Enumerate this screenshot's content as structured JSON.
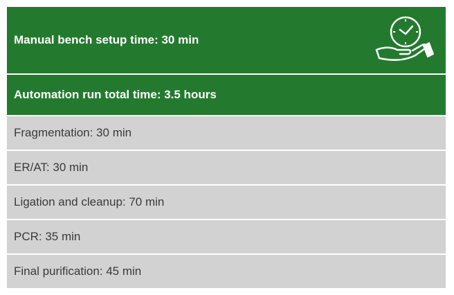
{
  "header": {
    "setup_label": "Manual bench setup time: 30 min",
    "icon": "clock-in-hand-icon",
    "run_label": "Automation run total time: 3.5 hours"
  },
  "steps": [
    {
      "label": "Fragmentation: 30 min"
    },
    {
      "label": "ER/AT: 30 min"
    },
    {
      "label": "Ligation and cleanup: 70 min"
    },
    {
      "label": "PCR: 35 min"
    },
    {
      "label": "Final purification: 45 min"
    }
  ],
  "colors": {
    "header_green": "#237a2e",
    "row_gray": "#d2d2d2",
    "text_dark": "#3a3a3a"
  }
}
